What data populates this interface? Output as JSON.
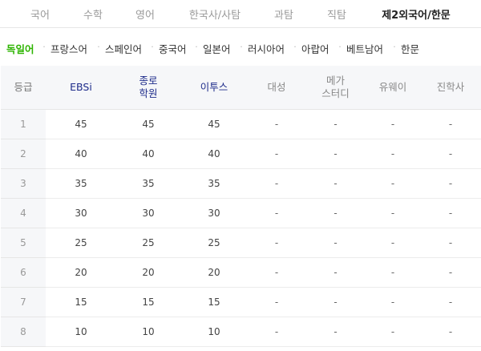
{
  "subject_tabs": [
    {
      "label": "국어"
    },
    {
      "label": "수학"
    },
    {
      "label": "영어"
    },
    {
      "label": "한국사/사탐"
    },
    {
      "label": "과탐"
    },
    {
      "label": "직탐"
    },
    {
      "label": "제2외국어/한문",
      "active": true
    }
  ],
  "languages": [
    {
      "label": "독일어",
      "active": true
    },
    {
      "label": "프랑스어"
    },
    {
      "label": "스페인어"
    },
    {
      "label": "중국어"
    },
    {
      "label": "일본어"
    },
    {
      "label": "러시아어"
    },
    {
      "label": "아랍어"
    },
    {
      "label": "베트남어"
    },
    {
      "label": "한문"
    }
  ],
  "table": {
    "grade_header": "등급",
    "providers": [
      {
        "line1": "EBSi",
        "line2": "",
        "highlight": true
      },
      {
        "line1": "종로",
        "line2": "학원",
        "highlight": true
      },
      {
        "line1": "이투스",
        "line2": "",
        "highlight": true
      },
      {
        "line1": "대성",
        "line2": "",
        "highlight": false
      },
      {
        "line1": "메가",
        "line2": "스터디",
        "highlight": false
      },
      {
        "line1": "유웨이",
        "line2": "",
        "highlight": false
      },
      {
        "line1": "진학사",
        "line2": "",
        "highlight": false
      }
    ],
    "rows": [
      {
        "grade": "1",
        "values": [
          "45",
          "45",
          "45",
          "-",
          "-",
          "-",
          "-"
        ]
      },
      {
        "grade": "2",
        "values": [
          "40",
          "40",
          "40",
          "-",
          "-",
          "-",
          "-"
        ]
      },
      {
        "grade": "3",
        "values": [
          "35",
          "35",
          "35",
          "-",
          "-",
          "-",
          "-"
        ]
      },
      {
        "grade": "4",
        "values": [
          "30",
          "30",
          "30",
          "-",
          "-",
          "-",
          "-"
        ]
      },
      {
        "grade": "5",
        "values": [
          "25",
          "25",
          "25",
          "-",
          "-",
          "-",
          "-"
        ]
      },
      {
        "grade": "6",
        "values": [
          "20",
          "20",
          "20",
          "-",
          "-",
          "-",
          "-"
        ]
      },
      {
        "grade": "7",
        "values": [
          "15",
          "15",
          "15",
          "-",
          "-",
          "-",
          "-"
        ]
      },
      {
        "grade": "8",
        "values": [
          "10",
          "10",
          "10",
          "-",
          "-",
          "-",
          "-"
        ]
      }
    ]
  },
  "colors": {
    "active_language": "#2db400",
    "provider_header": "#1d2b8a",
    "header_background": "#f6f7f9"
  }
}
